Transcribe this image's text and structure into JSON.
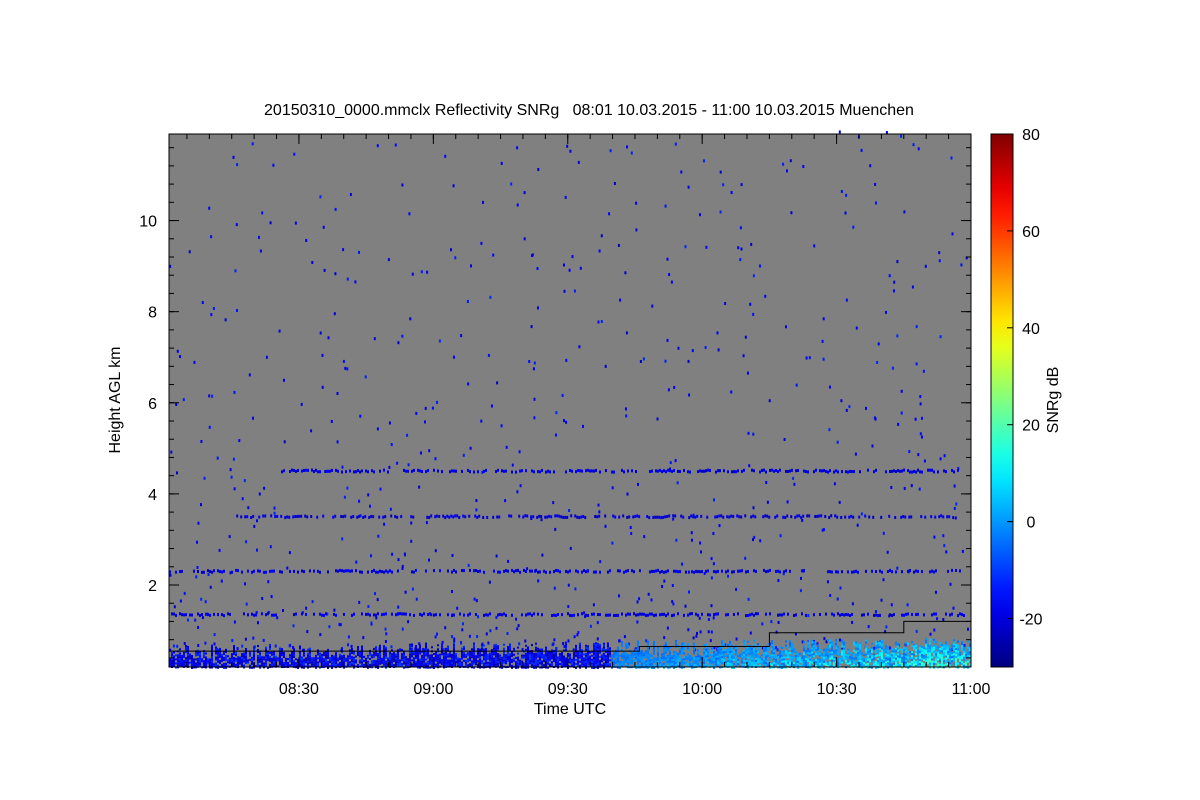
{
  "chart_data": {
    "type": "heatmap",
    "title": "20150310_0000.mmclx Reflectivity SNRg   08:01 10.03.2015 - 11:00 10.03.2015 Muenchen",
    "xlabel": "Time UTC",
    "ylabel": "Height AGL km",
    "x_start_utc": "08:01",
    "x_end_utc": "11:00",
    "x_ticks": [
      "08:30",
      "09:00",
      "09:30",
      "10:00",
      "10:30",
      "11:00"
    ],
    "ylim_km": [
      0.2,
      11.9
    ],
    "y_ticks": [
      2,
      4,
      6,
      8,
      10
    ],
    "colorbar": {
      "label": "SNRg dB",
      "range_db": [
        -30,
        80
      ],
      "ticks": [
        -20,
        0,
        20,
        40,
        60,
        80
      ],
      "colormap": "jet"
    },
    "background_color": "#808080",
    "features": [
      {
        "type": "layer",
        "height_km": 4.5,
        "time_range": [
          "08:26",
          "10:57"
        ],
        "snr_db": -20
      },
      {
        "type": "layer",
        "height_km": 3.5,
        "time_range": [
          "08:16",
          "10:57"
        ],
        "snr_db": -20
      },
      {
        "type": "layer",
        "height_km": 2.3,
        "time_range": [
          "08:01",
          "11:00"
        ],
        "snr_db": -20
      },
      {
        "type": "layer",
        "height_km": 1.35,
        "time_range": [
          "08:01",
          "11:00"
        ],
        "snr_db": -20
      },
      {
        "type": "boundary_layer",
        "height_km_max": 0.8,
        "time_range": [
          "08:01",
          "11:00"
        ],
        "snr_db_max": 20
      }
    ],
    "cloud_base_line": [
      {
        "time_utc": "08:01",
        "height_km": 0.55
      },
      {
        "time_utc": "09:46",
        "height_km": 0.55
      },
      {
        "time_utc": "09:46",
        "height_km": 0.65
      },
      {
        "time_utc": "10:15",
        "height_km": 0.65
      },
      {
        "time_utc": "10:15",
        "height_km": 0.95
      },
      {
        "time_utc": "10:45",
        "height_km": 0.95
      },
      {
        "time_utc": "10:45",
        "height_km": 1.2
      },
      {
        "time_utc": "11:00",
        "height_km": 1.2
      }
    ],
    "grid": false,
    "legend": "colorbar-right"
  }
}
